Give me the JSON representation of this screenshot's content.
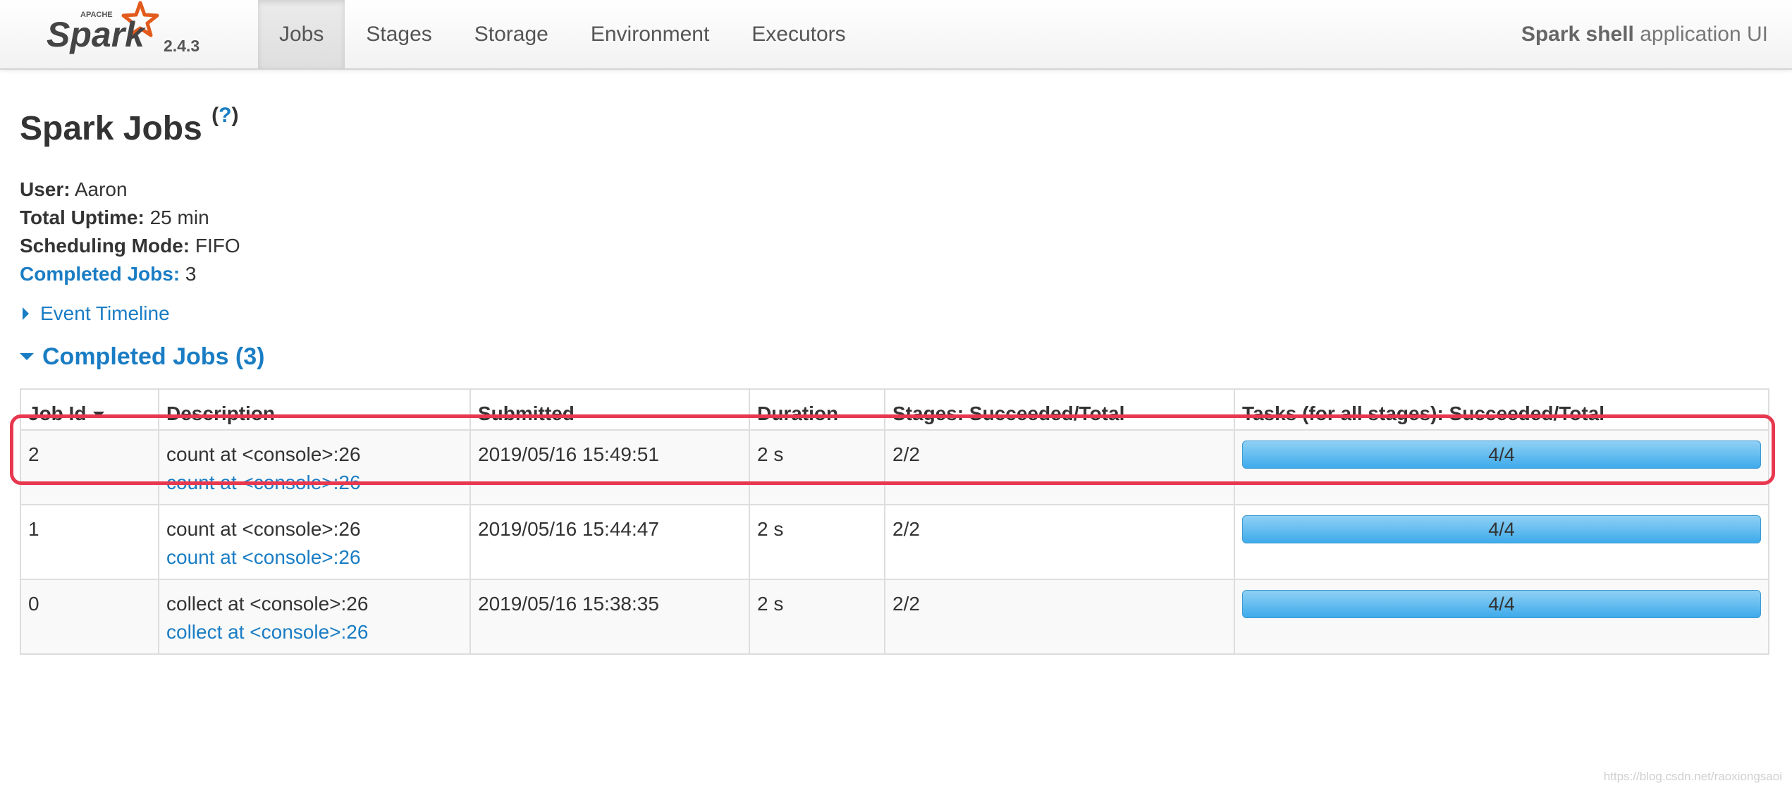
{
  "brand": {
    "apache_label": "APACHE",
    "logo_text": "Spark",
    "version": "2.4.3"
  },
  "nav": {
    "tabs": [
      {
        "label": "Jobs",
        "active": true
      },
      {
        "label": "Stages",
        "active": false
      },
      {
        "label": "Storage",
        "active": false
      },
      {
        "label": "Environment",
        "active": false
      },
      {
        "label": "Executors",
        "active": false
      }
    ],
    "app_name": "Spark shell",
    "app_suffix": " application UI"
  },
  "page": {
    "title": "Spark Jobs",
    "help_link": "?"
  },
  "summary": {
    "user_label": "User:",
    "user_value": "Aaron",
    "uptime_label": "Total Uptime:",
    "uptime_value": "25 min",
    "scheduling_label": "Scheduling Mode:",
    "scheduling_value": "FIFO",
    "completed_label": "Completed Jobs:",
    "completed_value": "3"
  },
  "event_timeline": {
    "label": "Event Timeline"
  },
  "completed_jobs": {
    "heading": "Completed Jobs (3)",
    "columns": [
      "Job Id",
      "Description",
      "Submitted",
      "Duration",
      "Stages: Succeeded/Total",
      "Tasks (for all stages): Succeeded/Total"
    ],
    "rows": [
      {
        "job_id": "2",
        "desc": "count at <console>:26",
        "desc_link": "count at <console>:26",
        "submitted": "2019/05/16 15:49:51",
        "duration": "2 s",
        "stages": "2/2",
        "tasks": "4/4",
        "tasks_fraction": 1.0
      },
      {
        "job_id": "1",
        "desc": "count at <console>:26",
        "desc_link": "count at <console>:26",
        "submitted": "2019/05/16 15:44:47",
        "duration": "2 s",
        "stages": "2/2",
        "tasks": "4/4",
        "tasks_fraction": 1.0
      },
      {
        "job_id": "0",
        "desc": "collect at <console>:26",
        "desc_link": "collect at <console>:26",
        "submitted": "2019/05/16 15:38:35",
        "duration": "2 s",
        "stages": "2/2",
        "tasks": "4/4",
        "tasks_fraction": 1.0
      }
    ]
  },
  "watermark": "https://blog.csdn.net/raoxiongsaoi",
  "colors": {
    "link": "#1a7dc4",
    "progress": "#3eabeb",
    "highlight": "#e8384f",
    "logo_orange": "#e25a1c"
  }
}
